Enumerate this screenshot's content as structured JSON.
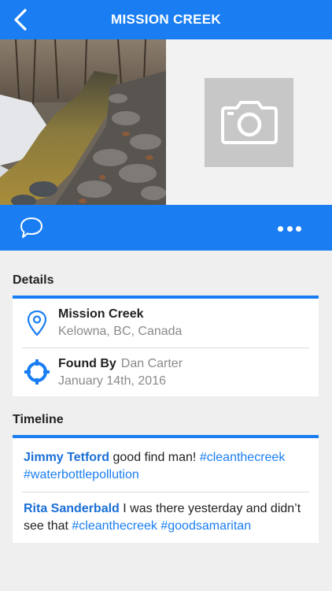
{
  "header": {
    "title": "MISSION CREEK",
    "back_icon": "chevron-left-icon"
  },
  "photos": {
    "add_photo_icon": "camera-icon"
  },
  "actions": {
    "comment_icon": "speech-bubble-icon",
    "more_icon": "ellipsis-icon"
  },
  "details": {
    "section_title": "Details",
    "location": {
      "icon": "map-pin-icon",
      "name": "Mission Creek",
      "place": "Kelowna, BC, Canada"
    },
    "found": {
      "icon": "crosshair-icon",
      "label": "Found By",
      "name": "Dan Carter",
      "date": "January 14th, 2016"
    }
  },
  "timeline": {
    "section_title": "Timeline",
    "entries": [
      {
        "user": "Jimmy Tetford",
        "text": " good find man! ",
        "tags": [
          "#cleanthecreek",
          "#waterbottlepollution"
        ]
      },
      {
        "user": "Rita Sanderbald",
        "text": " I was there yesterday and didn’t see that ",
        "tags": [
          "#cleanthecreek",
          "#goodsamaritan"
        ]
      }
    ]
  },
  "colors": {
    "accent": "#1a7ef2",
    "background": "#efeff0",
    "link": "#1a6fd6",
    "muted": "#8a8a8a"
  }
}
